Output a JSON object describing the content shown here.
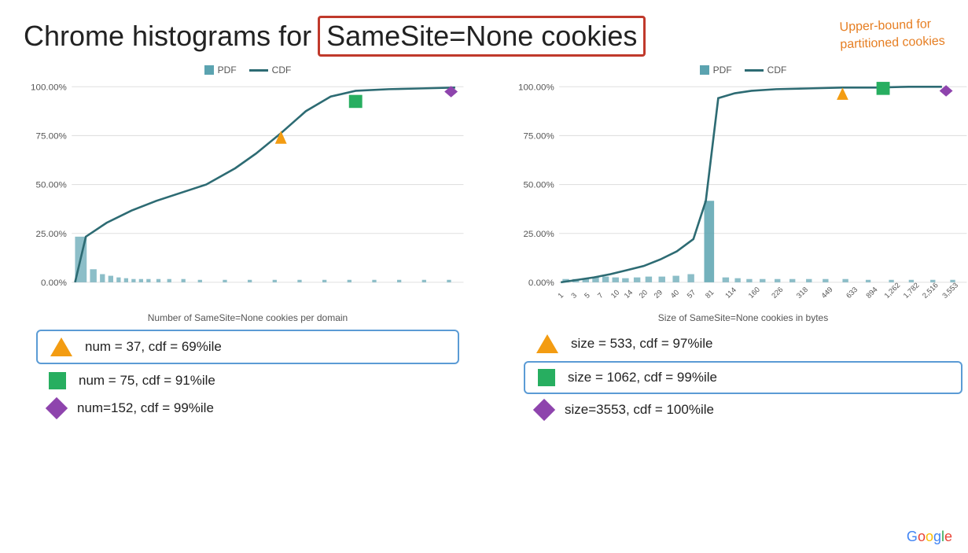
{
  "title": {
    "prefix": "Chrome histograms for",
    "highlight": "SameSite=None cookies",
    "annotation_line1": "Upper-bound for",
    "annotation_line2": "partitioned cookies"
  },
  "legend": {
    "pdf_label": "PDF",
    "cdf_label": "CDF"
  },
  "left_chart": {
    "title": "Number of SameSite=None cookies per domain",
    "y_labels": [
      "100.00%",
      "75.00%",
      "50.00%",
      "25.00%",
      "0.00%"
    ],
    "annotations": [
      {
        "marker": "triangle-orange",
        "text": "num = 37, cdf = 69%ile",
        "highlighted": true
      },
      {
        "marker": "square-green",
        "text": "num = 75, cdf = 91%ile",
        "highlighted": false
      },
      {
        "marker": "diamond-purple",
        "text": "num=152, cdf = 99%ile",
        "highlighted": false
      }
    ]
  },
  "right_chart": {
    "title": "Size of SameSite=None cookies in bytes",
    "y_labels": [
      "100.00%",
      "75.00%",
      "50.00%",
      "25.00%",
      "0.00%"
    ],
    "x_labels": [
      "1",
      "3",
      "5",
      "7",
      "10",
      "14",
      "20",
      "29",
      "40",
      "57",
      "81",
      "114",
      "160",
      "226",
      "318",
      "449",
      "633",
      "894",
      "1,262",
      "1,782",
      "2,516",
      "3,553"
    ],
    "annotations": [
      {
        "marker": "triangle-orange",
        "text": "size = 533, cdf = 97%ile",
        "highlighted": false
      },
      {
        "marker": "square-green",
        "text": "size = 1062, cdf = 99%ile",
        "highlighted": true
      },
      {
        "marker": "diamond-purple",
        "text": "size=3553, cdf = 100%ile",
        "highlighted": false
      }
    ]
  },
  "google_logo": "Google"
}
